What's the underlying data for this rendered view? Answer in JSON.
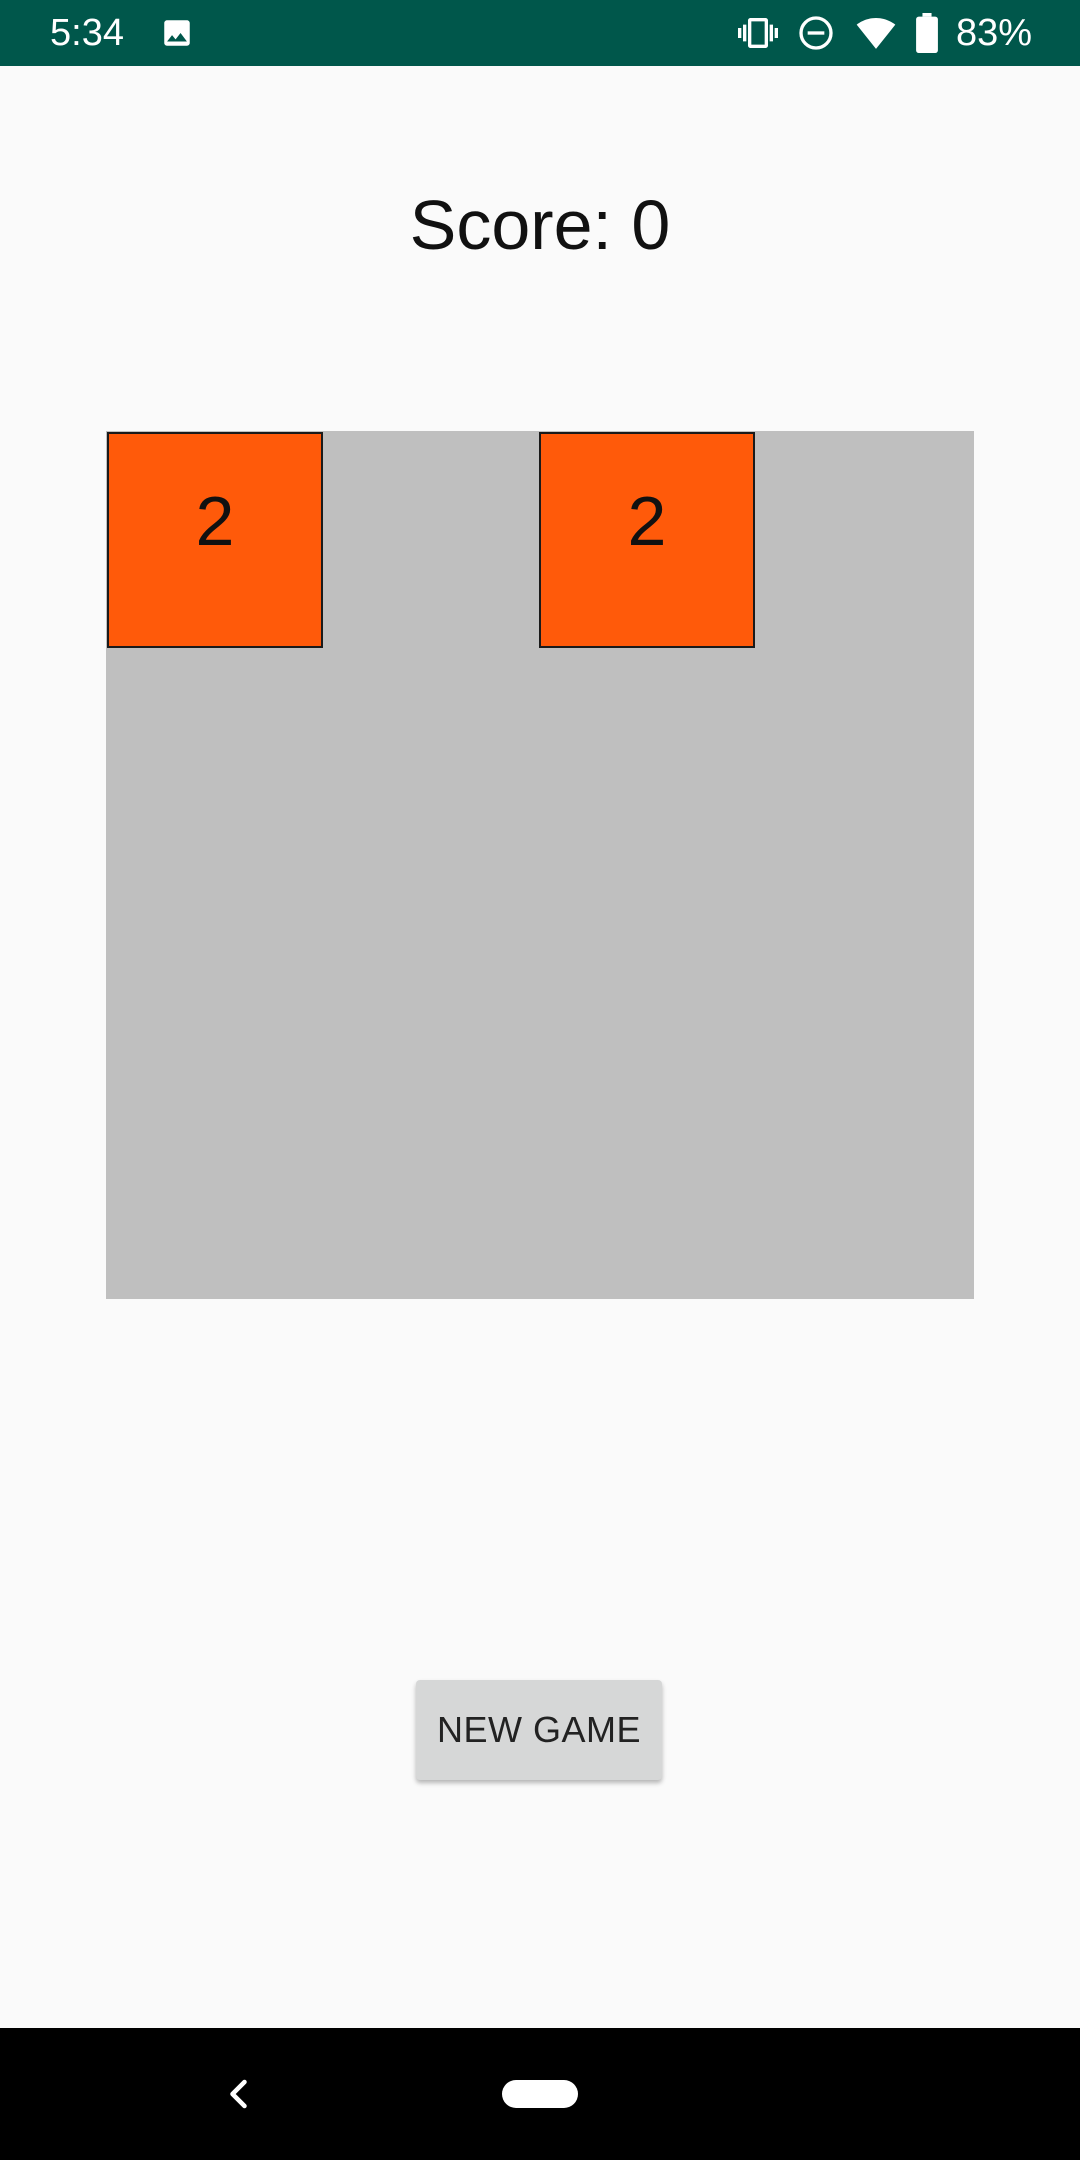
{
  "status_bar": {
    "time": "5:34",
    "battery_percent": "83%",
    "icons": [
      "image-icon",
      "vibrate-icon",
      "do-not-disturb-icon",
      "wifi-icon",
      "battery-icon"
    ]
  },
  "score": {
    "label": "Score: 0"
  },
  "board": {
    "background": "#bfbfbf",
    "tile_color": "#ff5a0a",
    "tiles": [
      {
        "row": 0,
        "col": 0,
        "value": "2"
      },
      {
        "row": 0,
        "col": 2,
        "value": "2"
      }
    ]
  },
  "new_game_button": {
    "label": "NEW GAME"
  },
  "nav_bar": {
    "icons": [
      "back-icon",
      "home-pill-icon"
    ]
  },
  "colors": {
    "status_bar": "#00574b",
    "background": "#fafafa"
  }
}
